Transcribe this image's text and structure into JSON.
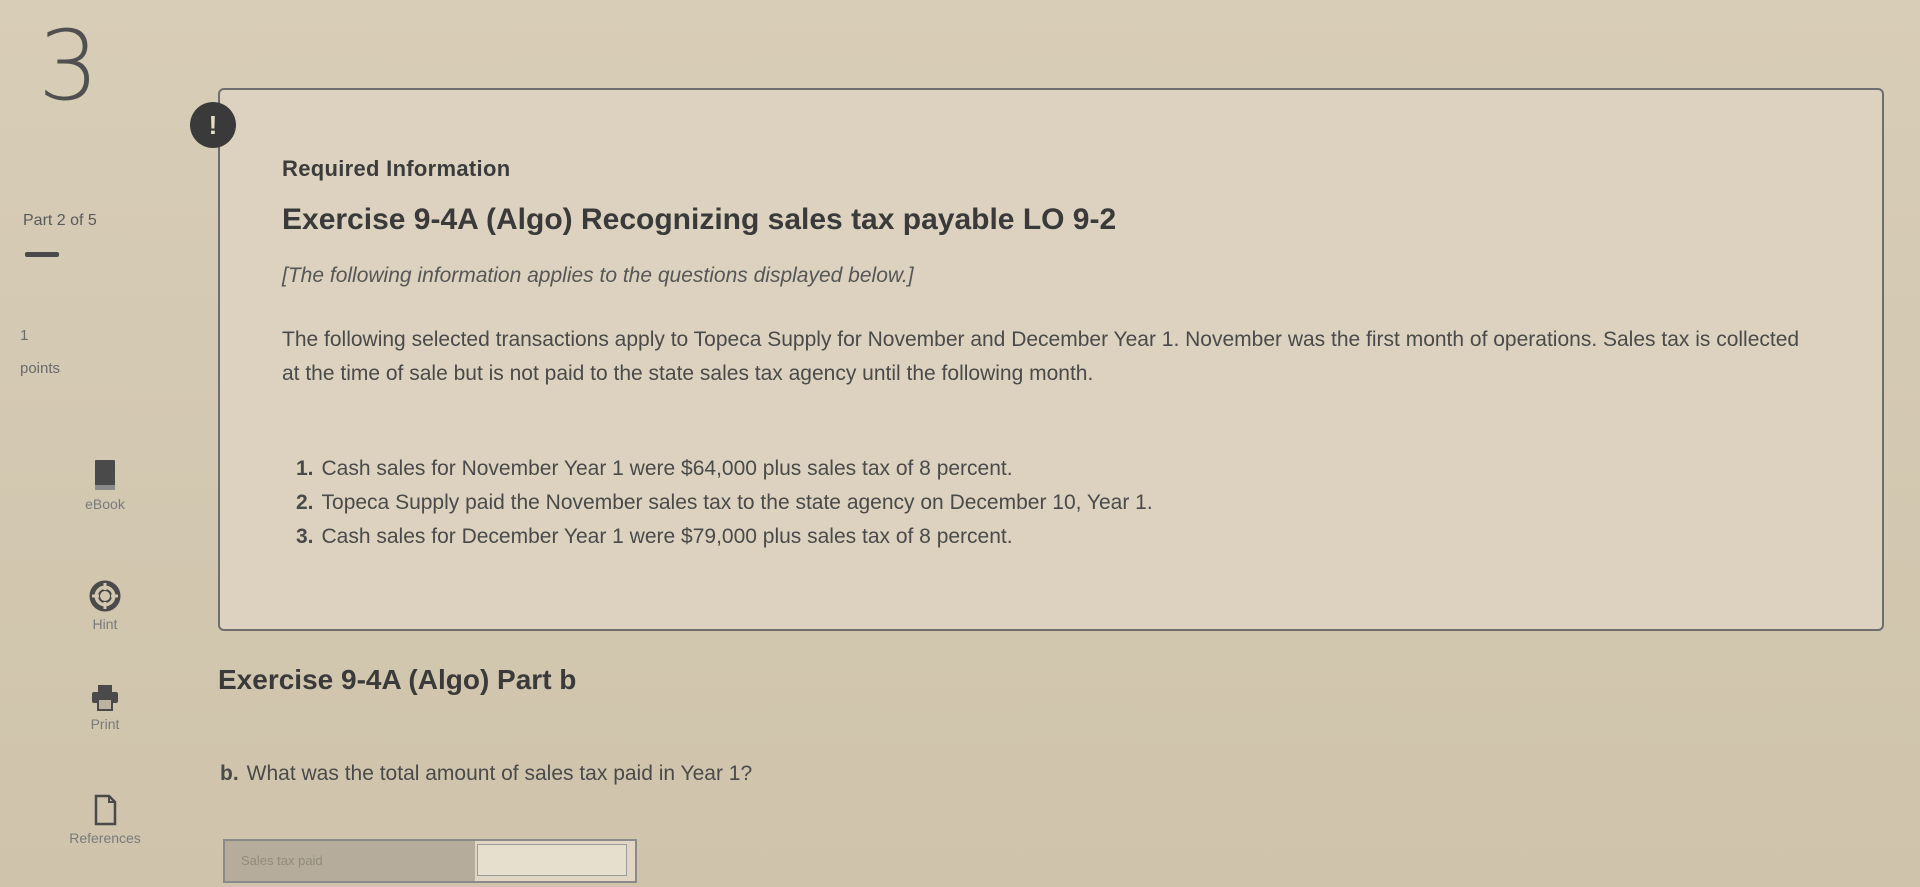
{
  "question": {
    "number": "3"
  },
  "sidebar": {
    "part_label": "Part 2 of 5",
    "points_value": "1",
    "points_label": "points",
    "tools": [
      {
        "label": "eBook",
        "icon": "book-icon"
      },
      {
        "label": "Hint",
        "icon": "lifebuoy-icon"
      },
      {
        "label": "Print",
        "icon": "printer-icon"
      },
      {
        "label": "References",
        "icon": "document-icon"
      }
    ]
  },
  "info": {
    "alert_icon": "!",
    "required_label": "Required Information",
    "exercise_title": "Exercise 9-4A (Algo) Recognizing sales tax payable LO 9-2",
    "applies_note": "[The following information applies to the questions displayed below.]",
    "intro": "The following selected transactions apply to Topeca Supply for November and December Year 1. November was the first month of operations. Sales tax is collected at the time of sale but is not paid to the state sales tax agency until the following month.",
    "transactions": [
      {
        "num": "1.",
        "text": "Cash sales for November Year 1 were $64,000 plus sales tax of 8 percent."
      },
      {
        "num": "2.",
        "text": "Topeca Supply paid the November sales tax to the state agency on December 10, Year 1."
      },
      {
        "num": "3.",
        "text": "Cash sales for December Year 1 were $79,000 plus sales tax of 8 percent."
      }
    ]
  },
  "part": {
    "title": "Exercise 9-4A (Algo) Part b",
    "question_num": "b.",
    "question_text": "What was the total amount of sales tax paid in Year 1?",
    "answer_label": "Sales tax paid",
    "answer_value": ""
  }
}
